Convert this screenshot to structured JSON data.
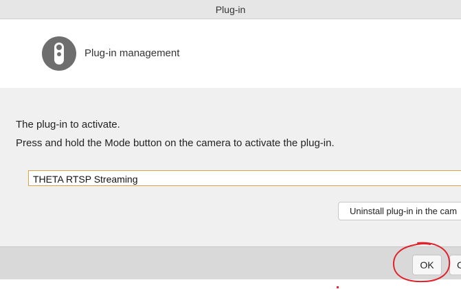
{
  "window": {
    "title": "Plug-in"
  },
  "header": {
    "title": "Plug-in management",
    "icon": "theta-camera-icon"
  },
  "content": {
    "instruction_line1": "The plug-in to activate.",
    "instruction_line2": "Press and hold the Mode button on the camera to activate the plug-in.",
    "selected_plugin": "THETA RTSP Streaming",
    "uninstall_label": "Uninstall plug-in in the cam"
  },
  "footer": {
    "ok_label": "OK",
    "cancel_label": "C"
  },
  "colors": {
    "titlebar": "#e6e6e6",
    "content_bg": "#f0f0f0",
    "footer_bg": "#d9d9d9",
    "select_border": "#d9a04a",
    "annotation_red": "#e0202a"
  }
}
